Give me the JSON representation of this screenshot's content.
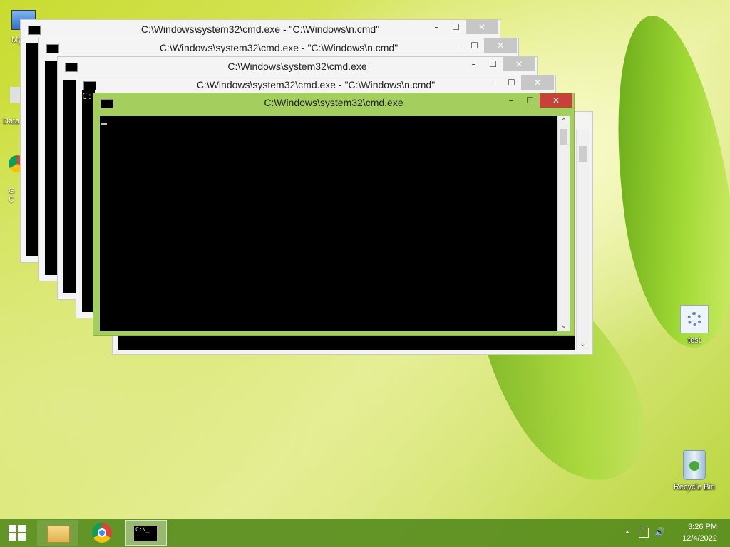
{
  "desktop": {
    "icons": [
      {
        "label": "test"
      },
      {
        "label": "Recycle Bin"
      }
    ],
    "edge_labels": [
      "My C",
      "Data",
      "G",
      "C"
    ]
  },
  "windows": [
    {
      "title": "C:\\Windows\\system32\\cmd.exe - \"C:\\Windows\\n.cmd\""
    },
    {
      "title": "C:\\Windows\\system32\\cmd.exe - \"C:\\Windows\\n.cmd\""
    },
    {
      "title": "C:\\Windows\\system32\\cmd.exe"
    },
    {
      "title": "C:\\Windows\\system32\\cmd.exe - \"C:\\Windows\\n.cmd\""
    },
    {
      "title": "C:\\Windows\\system32\\cmd.exe"
    }
  ],
  "console_partial_text": "C:",
  "controls": {
    "minimize": "–",
    "maximize": "☐",
    "close": "✕"
  },
  "taskbar": {
    "cmd_icon_text": "C:\\_",
    "tray_arrow": "▲",
    "time": "3:26 PM",
    "date": "12/4/2022"
  },
  "colors": {
    "active_frame": "#a4cf5e",
    "close_active": "#c7403a",
    "taskbar": "#588c1e"
  }
}
